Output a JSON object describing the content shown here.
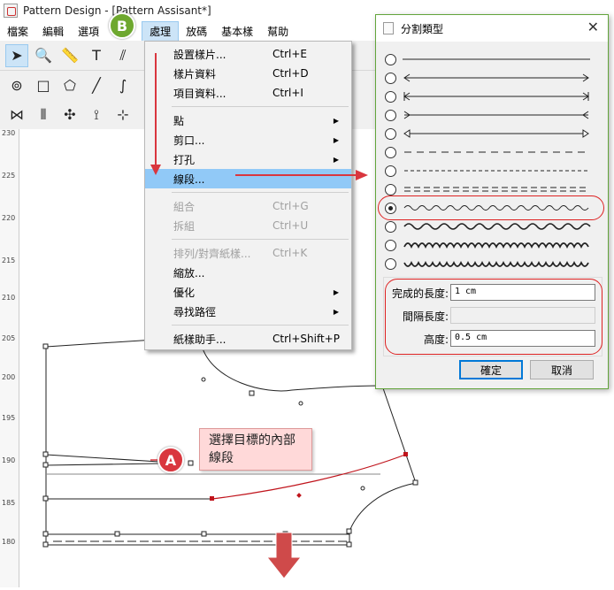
{
  "window": {
    "title": "Pattern Design - [Pattern Assisant*]"
  },
  "menubar": [
    "檔案",
    "編輯",
    "選項",
    "檢視",
    "處理",
    "放碼",
    "基本樣",
    "幫助"
  ],
  "ruler": {
    "ticks": [
      "230",
      "225",
      "220",
      "215",
      "210",
      "205",
      "200",
      "195",
      "190",
      "185",
      "180"
    ]
  },
  "menu": {
    "items": [
      {
        "label": "設置樣片...",
        "shortcut": "Ctrl+E"
      },
      {
        "label": "樣片資料",
        "shortcut": "Ctrl+D"
      },
      {
        "label": "項目資料...",
        "shortcut": "Ctrl+I"
      },
      {
        "label": "點",
        "shortcut": ""
      },
      {
        "label": "剪口...",
        "shortcut": ""
      },
      {
        "label": "打孔",
        "shortcut": ""
      },
      {
        "label": "線段...",
        "shortcut": ""
      },
      {
        "label": "組合",
        "shortcut": "Ctrl+G"
      },
      {
        "label": "拆組",
        "shortcut": "Ctrl+U"
      },
      {
        "label": "排列/對齊紙樣...",
        "shortcut": "Ctrl+K"
      },
      {
        "label": "縮放...",
        "shortcut": ""
      },
      {
        "label": "優化",
        "shortcut": ""
      },
      {
        "label": "尋找路徑",
        "shortcut": ""
      },
      {
        "label": "紙樣助手...",
        "shortcut": "Ctrl+Shift+P"
      }
    ]
  },
  "dialog": {
    "title": "分割類型",
    "length_label": "完成的長度:",
    "length_value": "1 cm",
    "interval_label": "間隔長度:",
    "interval_value": "",
    "height_label": "高度:",
    "height_value": "0.5 cm",
    "ok_label": "確定",
    "cancel_label": "取消",
    "selected_index": 8
  },
  "annotations": {
    "badge_a": "A",
    "badge_b": "B",
    "callout_text": "選擇目標的內部線段"
  },
  "colors": {
    "accent_red": "#d9363e",
    "accent_green": "#6ea82f",
    "highlight": "#91c9f7"
  }
}
